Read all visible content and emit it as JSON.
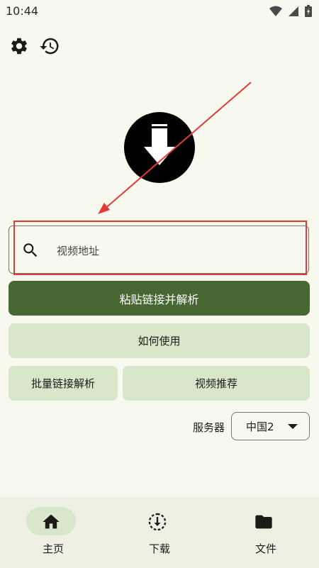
{
  "status_bar": {
    "time": "10:44"
  },
  "top_icons": [
    "gear-icon",
    "history-icon"
  ],
  "search": {
    "placeholder": "视频地址",
    "value": ""
  },
  "buttons": {
    "paste_parse": "粘贴链接并解析",
    "how_to_use": "如何使用",
    "batch_parse": "批量链接解析",
    "recommend": "视频推荐"
  },
  "server": {
    "label": "服务器",
    "selected": "中国2"
  },
  "bottom_nav": {
    "items": [
      {
        "label": "主页",
        "icon": "home-icon",
        "active": true
      },
      {
        "label": "下载",
        "icon": "download-icon",
        "active": false
      },
      {
        "label": "文件",
        "icon": "folder-icon",
        "active": false
      }
    ]
  },
  "colors": {
    "background": "#f8f9ee",
    "primary": "#476733",
    "secondary_container": "#d8e6c9",
    "nav_background": "#edf0e3",
    "annotation": "#e53935"
  }
}
